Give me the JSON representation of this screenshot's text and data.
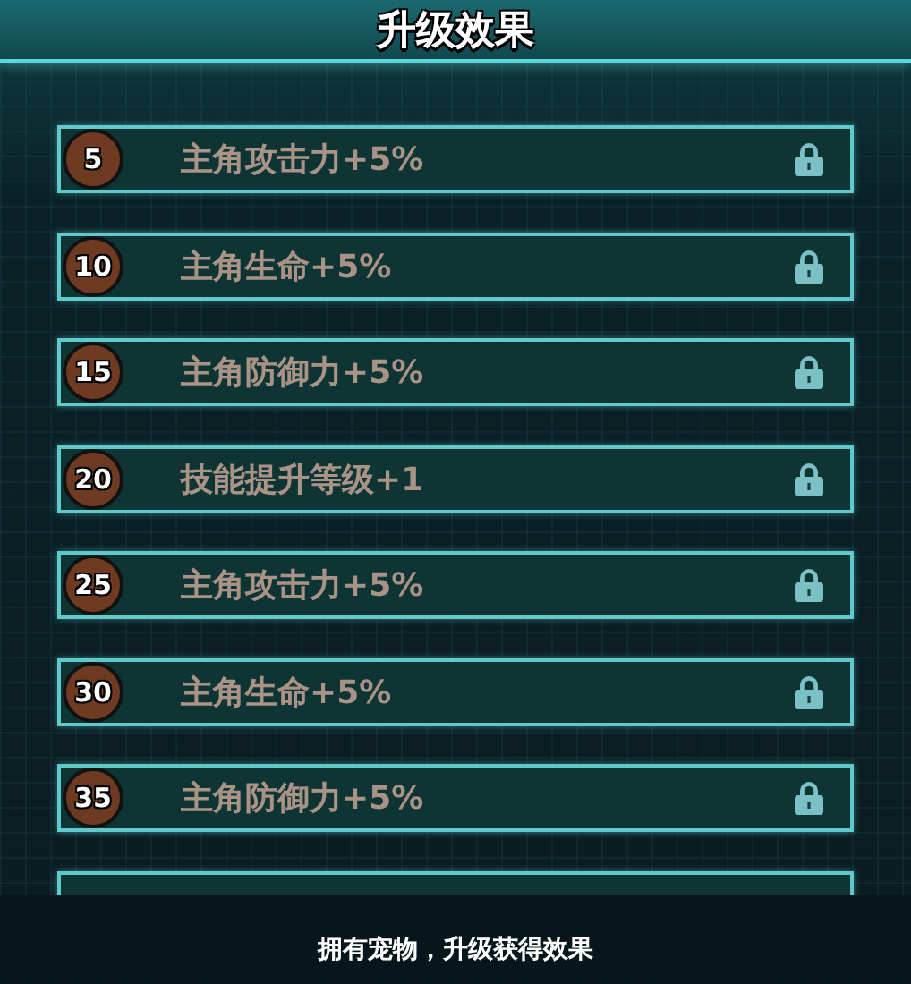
{
  "title": "升级效果",
  "effects": [
    {
      "level": "5",
      "label": "主角攻击力+5%",
      "locked": true
    },
    {
      "level": "10",
      "label": "主角生命+5%",
      "locked": true
    },
    {
      "level": "15",
      "label": "主角防御力+5%",
      "locked": true
    },
    {
      "level": "20",
      "label": "技能提升等级+1",
      "locked": true
    },
    {
      "level": "25",
      "label": "主角攻击力+5%",
      "locked": true
    },
    {
      "level": "30",
      "label": "主角生命+5%",
      "locked": true
    },
    {
      "level": "35",
      "label": "主角防御力+5%",
      "locked": true
    },
    {
      "kind": "cut"
    }
  ],
  "footer": "拥有宠物，升级获得效果"
}
